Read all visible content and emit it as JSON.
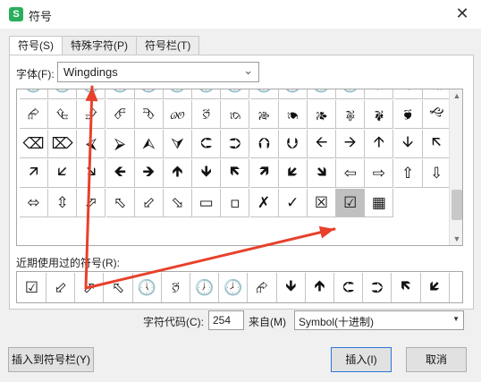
{
  "window": {
    "app_icon_letter": "S",
    "title": "符号",
    "close_glyph": "✕"
  },
  "tabs": [
    {
      "label": "符号(S)",
      "active": true
    },
    {
      "label": "特殊字符(P)",
      "active": false
    },
    {
      "label": "符号栏(T)",
      "active": false
    }
  ],
  "font": {
    "label": "字体(F):",
    "value": "Wingdings",
    "chevron": "⌄"
  },
  "symbol_grid": {
    "rows": [
      [
        "🕐",
        "🕑",
        "🕒",
        "🕓",
        "🕔",
        "🕕",
        "🕖",
        "🕗",
        "🕘",
        "🕙",
        "🕚",
        "🕛",
        "⮰",
        "⮱",
        "⮲"
      ],
      [
        "⮳",
        "⮴",
        "⮵",
        "⮶",
        "⮷",
        "🙐",
        "🙑",
        "🙒",
        "🙓",
        "🙔",
        "🙕",
        "🙖",
        "🙗",
        "🙘",
        "🙙"
      ],
      [
        "⌫",
        "⌦",
        "⮘",
        "⮚",
        "⮙",
        "⮛",
        "⮈",
        "⮊",
        "⮉",
        "⮋",
        "🡨",
        "🡪",
        "🡩",
        "🡫",
        "🡬"
      ],
      [
        "🡭",
        "🡯",
        "🡮",
        "🡸",
        "🡺",
        "🡹",
        "🡻",
        "🡼",
        "🡽",
        "🡿",
        "🡾",
        "⇦",
        "⇨",
        "⇧",
        "⇩"
      ],
      [
        "⬄",
        "⇳",
        "⬀",
        "⬁",
        "⬃",
        "⬂",
        "▭",
        "▫",
        "✗",
        "✓",
        "☒",
        "☑",
        "▦",
        "",
        ""
      ]
    ],
    "selected_symbol": "☑"
  },
  "recent": {
    "label": "近期使用过的符号(R):",
    "symbols": [
      "☑",
      "⬃",
      "⬀",
      "⬁",
      "🕔",
      "🙑",
      "🕖",
      "🕗",
      "⮳",
      "🡻",
      "🡹",
      "⮈",
      "⮊",
      "🡼",
      "🡿"
    ]
  },
  "char_code": {
    "label": "字符代码(C):",
    "value": "254"
  },
  "from": {
    "label": "来自(M)",
    "value": "Symbol(十进制)",
    "chevron": "▼"
  },
  "buttons": {
    "insert_to_bar": "插入到符号栏(Y)",
    "insert": "插入(I)",
    "cancel": "取消"
  },
  "scroll": {
    "up": "▲",
    "down": "▼"
  },
  "colors": {
    "arrow": "#e8402a",
    "accent": "#2aae5b"
  }
}
